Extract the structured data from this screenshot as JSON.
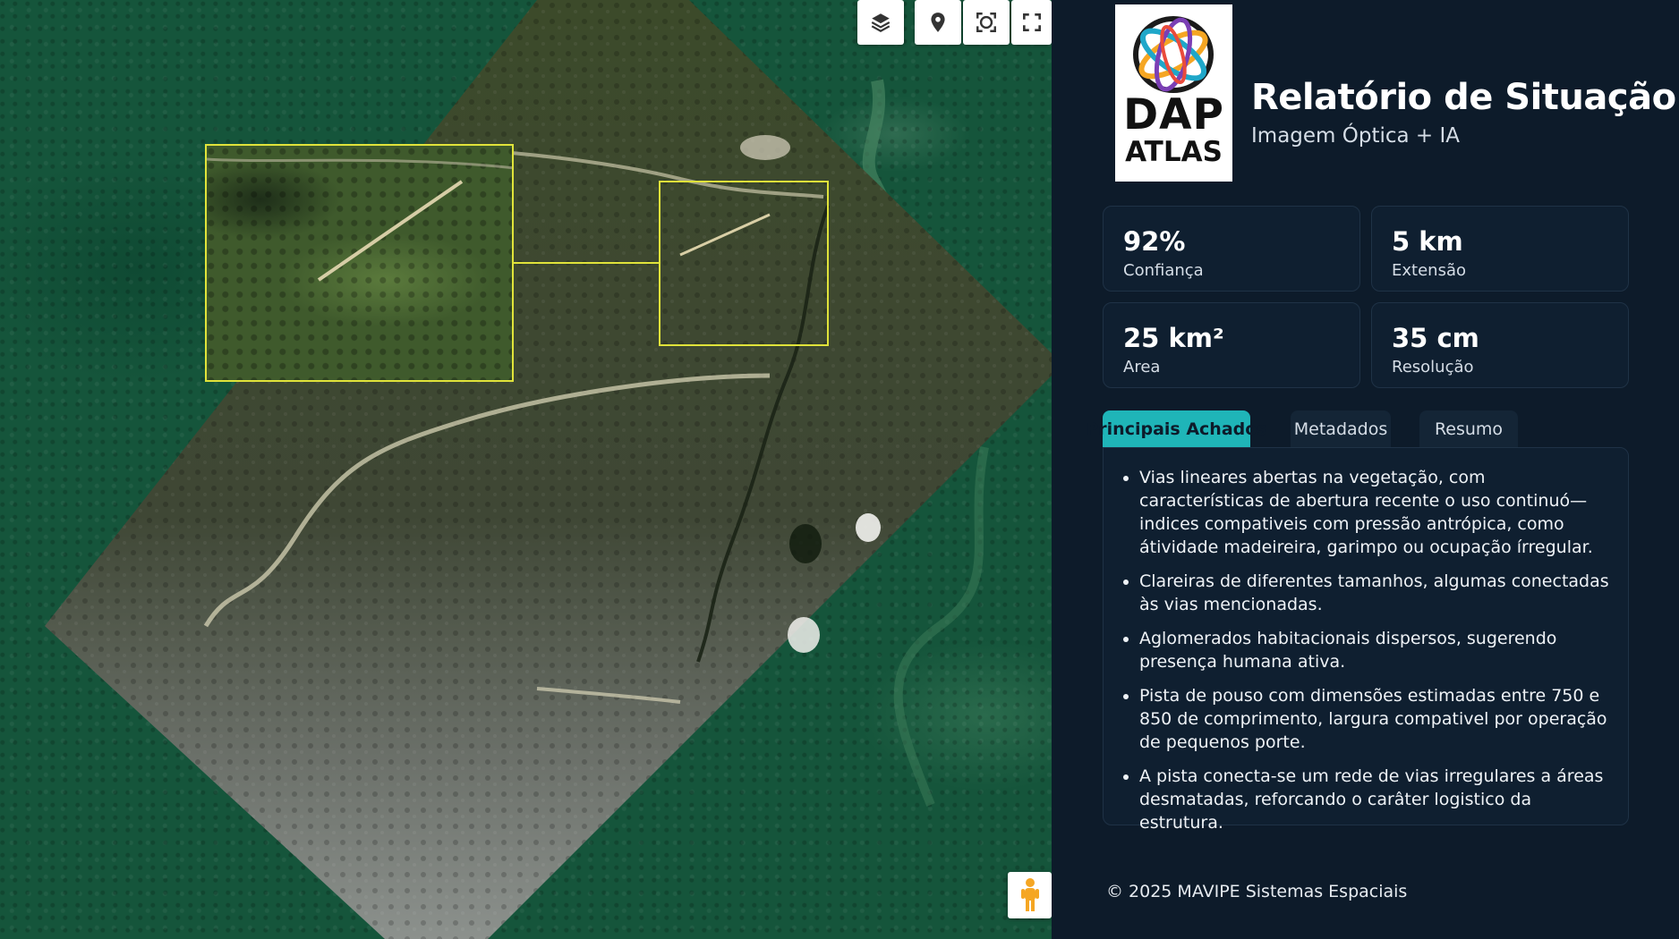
{
  "map": {
    "controls": [
      "layers-icon",
      "location-pin-icon",
      "scan-icon",
      "fullscreen-icon"
    ],
    "pegman": "street-view-icon",
    "highlight_color": "#e0e33a"
  },
  "panel": {
    "logo": {
      "word1": "DAP",
      "word2": "ATLAS"
    },
    "title": "Relatório de Situação",
    "subtitle": "Imagem Óptica + IA",
    "stats": [
      {
        "value": "92%",
        "label": "Confiança"
      },
      {
        "value": "5 km",
        "label": "Extensão"
      },
      {
        "value": "25 km²",
        "label": "Area"
      },
      {
        "value": "35 cm",
        "label": "Resolução"
      }
    ],
    "tabs": [
      {
        "label": "Principais Achados",
        "active": true
      },
      {
        "label": "Metadados",
        "active": false
      },
      {
        "label": "Resumo",
        "active": false
      }
    ],
    "findings": [
      "Vias lineares abertas na vegetação, com características de abertura recente o uso continuó— indices compativeis com pressão antrópica, como átividade madeireira, garimpo ou ocupação írregular.",
      "Clareiras de diferentes tamanhos, algumas conectadas às vias mencionadas.",
      "Aglomerados habitacionais dispersos, sugerendo presença humana ativa.",
      "Pista de pouso com dimensões estimadas entre 750 e 850 de comprimento, largura compativel por operação de pequenos porte.",
      "A pista conecta-se um rede de vias irregulares a áreas desmatadas, reforcando o carâter logistico da estrutura."
    ],
    "footer": "© 2025 MAVIPE Sistemas Espaciais",
    "colors": {
      "background": "#0d1b2a",
      "accent": "#1fb5b8"
    }
  }
}
